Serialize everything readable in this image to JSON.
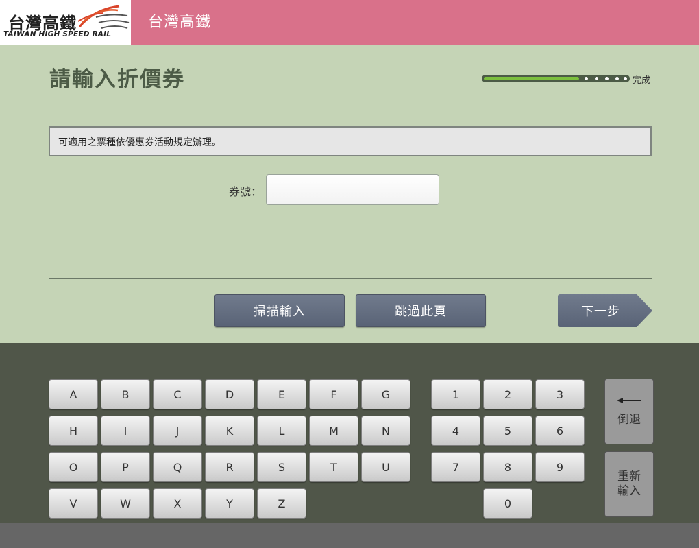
{
  "header": {
    "logo_cn": "台灣高鐵",
    "logo_en": "TAIWAN HIGH SPEED RAIL",
    "title": "台灣高鐵"
  },
  "main": {
    "page_title": "請輸入折價券",
    "progress": {
      "fraction": 0.66,
      "label": "完成"
    },
    "notice": "可適用之票種依優惠券活動規定辦理。",
    "coupon_label": "券號：",
    "coupon_value": "",
    "buttons": {
      "scan": "掃描輸入",
      "skip": "跳過此頁",
      "next": "下一步"
    }
  },
  "keyboard": {
    "letter_rows": [
      [
        "A",
        "B",
        "C",
        "D",
        "E",
        "F",
        "G"
      ],
      [
        "H",
        "I",
        "J",
        "K",
        "L",
        "M",
        "N"
      ],
      [
        "O",
        "P",
        "Q",
        "R",
        "S",
        "T",
        "U"
      ],
      [
        "V",
        "W",
        "X",
        "Y",
        "Z"
      ]
    ],
    "digit_rows": [
      [
        "1",
        "2",
        "3"
      ],
      [
        "4",
        "5",
        "6"
      ],
      [
        "7",
        "8",
        "9"
      ],
      [
        "0"
      ]
    ],
    "backspace": "倒退",
    "reset": "重新輸入"
  },
  "colors": {
    "header_pink": "#d9718a",
    "panel_green": "#c5d4b6",
    "keyboard_bg": "#505649",
    "progress_fill": "#7cbf3e",
    "button_slate": "#646e81"
  }
}
